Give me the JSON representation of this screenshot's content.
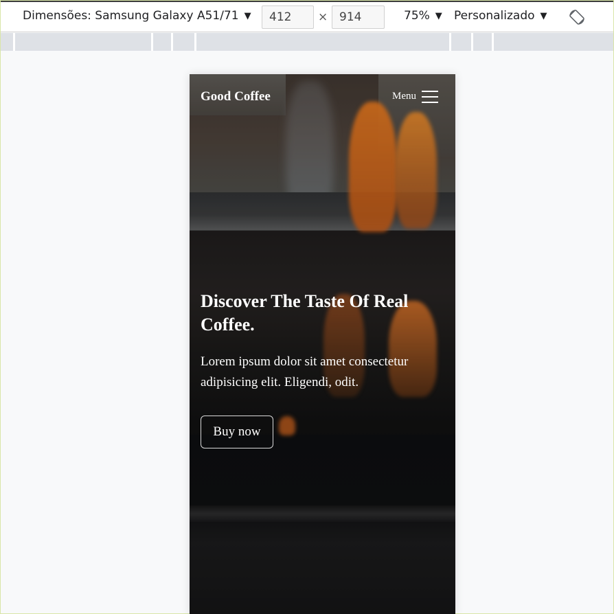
{
  "device_toolbar": {
    "dimensions_label": "Dimensões: Samsung Galaxy A51/71",
    "width_value": "412",
    "height_value": "914",
    "times_symbol": "×",
    "zoom_label": "75%",
    "throttle_label": "Personalizado",
    "rotate_icon": "rotate-icon"
  },
  "site": {
    "brand": "Good Coffee",
    "menu_label": "Menu",
    "hero_title": "Discover The Taste Of Real Coffee.",
    "hero_text": "Lorem ipsum dolor sit amet consectetur adipisicing elit. Eligendi, odit.",
    "buy_button": "Buy now"
  },
  "colors": {
    "toolbar_bg": "#ffffff",
    "ruler_bg": "#dee1e6",
    "page_bg": "#f8f9fa",
    "hero_text": "#ffffff"
  }
}
